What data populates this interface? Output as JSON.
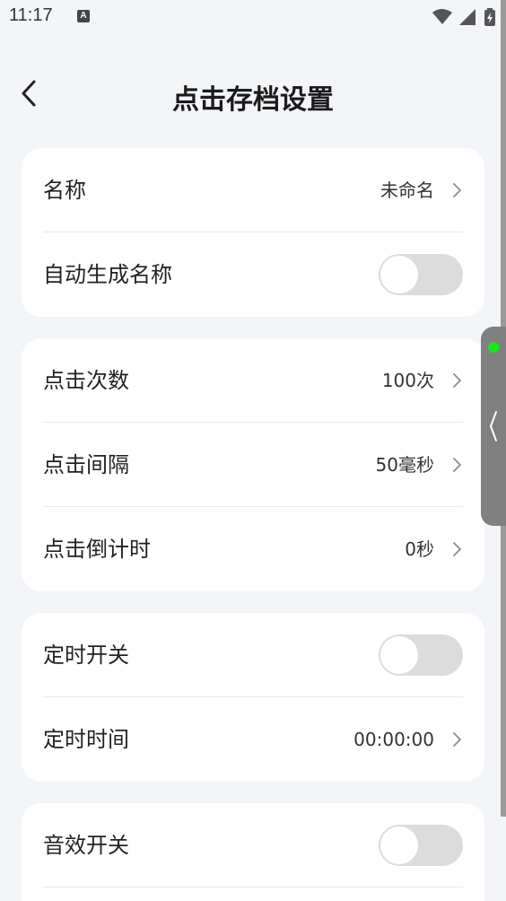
{
  "status_bar": {
    "time": "11:17",
    "notification_icon": "A",
    "icons": [
      "wifi-icon",
      "signal-icon",
      "battery-charging-icon"
    ]
  },
  "header": {
    "title": "点击存档设置",
    "back_icon": "chevron-left-icon"
  },
  "sections": {
    "basic": {
      "name_label": "名称",
      "name_value": "未命名",
      "auto_name_label": "自动生成名称",
      "auto_name_enabled": false
    },
    "click": {
      "count_label": "点击次数",
      "count_value": "100次",
      "interval_label": "点击间隔",
      "interval_value": "50毫秒",
      "countdown_label": "点击倒计时",
      "countdown_value": "0秒"
    },
    "timer": {
      "switch_label": "定时开关",
      "switch_enabled": false,
      "time_label": "定时时间",
      "time_value": "00:00:00"
    },
    "sound": {
      "switch_label": "音效开关",
      "switch_enabled": false
    }
  },
  "side_panel": {
    "indicator_color": "#1ce51c",
    "handle_icon": "chevron-left-icon"
  },
  "colors": {
    "background": "#f4f5f9",
    "card": "#ffffff",
    "toggle_off": "#dcdcdc",
    "handle": "#808080"
  }
}
